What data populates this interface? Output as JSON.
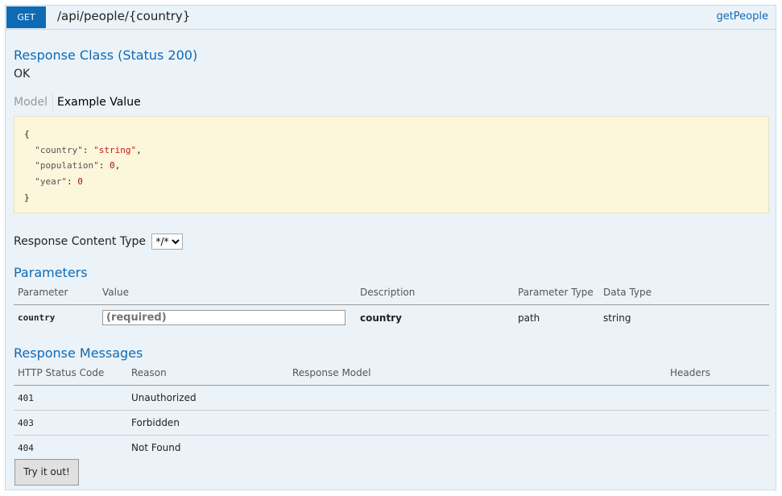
{
  "operation": {
    "method": "GET",
    "path": "/api/people/{country}",
    "nickname": "getPeople"
  },
  "response_class": {
    "heading": "Response Class (Status 200)",
    "description": "OK",
    "tabs": {
      "model": "Model",
      "example": "Example Value"
    },
    "example_lines": [
      {
        "pre": "{",
        "key": "",
        "sep": "",
        "value": "",
        "post": ""
      },
      {
        "pre": "  ",
        "key": "\"country\"",
        "sep": ": ",
        "value": "\"string\"",
        "post": ","
      },
      {
        "pre": "  ",
        "key": "\"population\"",
        "sep": ": ",
        "value": "0",
        "post": ","
      },
      {
        "pre": "  ",
        "key": "\"year\"",
        "sep": ": ",
        "value": "0",
        "post": ""
      },
      {
        "pre": "}",
        "key": "",
        "sep": "",
        "value": "",
        "post": ""
      }
    ]
  },
  "response_content_type": {
    "label": "Response Content Type",
    "selected": "*/*"
  },
  "parameters": {
    "heading": "Parameters",
    "columns": [
      "Parameter",
      "Value",
      "Description",
      "Parameter Type",
      "Data Type"
    ],
    "rows": [
      {
        "name": "country",
        "placeholder": "(required)",
        "description": "country",
        "param_type": "path",
        "data_type": "string"
      }
    ]
  },
  "response_messages": {
    "heading": "Response Messages",
    "columns": [
      "HTTP Status Code",
      "Reason",
      "Response Model",
      "Headers"
    ],
    "rows": [
      {
        "code": "401",
        "reason": "Unauthorized"
      },
      {
        "code": "403",
        "reason": "Forbidden"
      },
      {
        "code": "404",
        "reason": "Not Found"
      }
    ]
  },
  "try_button": "Try it out!"
}
